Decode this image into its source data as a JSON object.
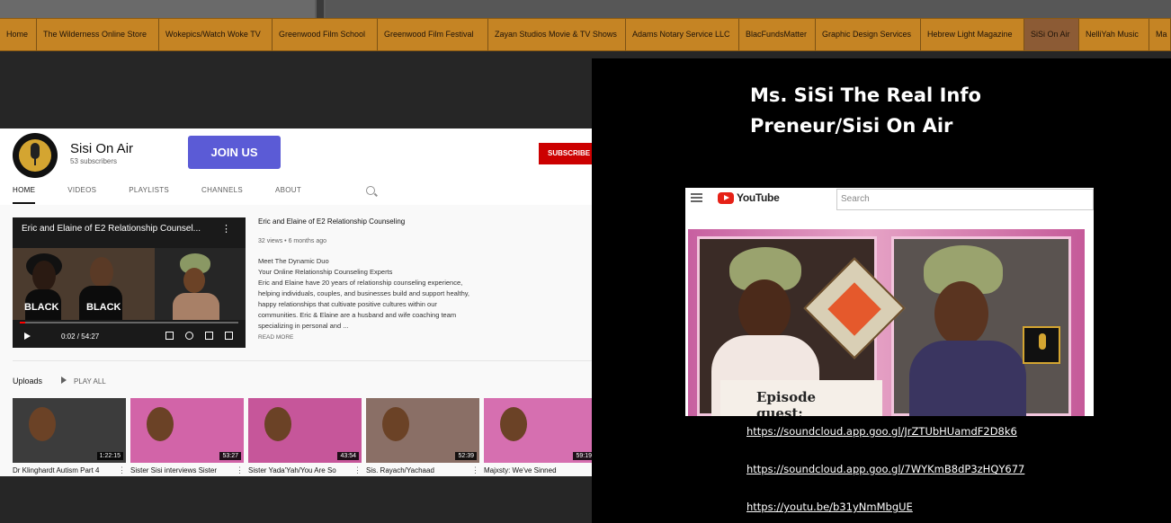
{
  "nav": {
    "items": [
      {
        "label": "Home",
        "width": 41
      },
      {
        "label": "The Wilderness Online Store",
        "width": 136
      },
      {
        "label": "Wokepics/Watch Woke TV",
        "width": 126
      },
      {
        "label": "Greenwood Film School",
        "width": 117
      },
      {
        "label": "Greenwood Film Festival",
        "width": 123
      },
      {
        "label": "Zayan Studios Movie & TV Shows",
        "width": 153
      },
      {
        "label": "Adams Notary Service LLC",
        "width": 126
      },
      {
        "label": "BlacFundsMatter",
        "width": 85
      },
      {
        "label": "Graphic Design Services",
        "width": 117
      },
      {
        "label": "Hebrew Light Magazine",
        "width": 115
      },
      {
        "label": "SiSi On Air",
        "width": 61,
        "active": true
      },
      {
        "label": "NelliYah Music",
        "width": 78
      },
      {
        "label": "Ma",
        "width": 24
      }
    ]
  },
  "youtube": {
    "channel_name": "Sisi On Air",
    "subscribers": "53 subscribers",
    "join_label": "JOIN US",
    "subscribe_label": "SUBSCRIBE",
    "tabs": [
      "HOME",
      "VIDEOS",
      "PLAYLISTS",
      "CHANNELS",
      "ABOUT"
    ],
    "featured": {
      "overlay_title": "Eric and Elaine of E2 Relationship Counsel...",
      "black_text_1": "BLACK",
      "black_text_2": "BLACK",
      "time": "0:02 / 54:27",
      "title": "Eric and Elaine of E2 Relationship Counseling",
      "meta": "32 views • 6 months ago",
      "description": "Meet The Dynamic Duo\nYour Online Relationship Counseling Experts\nEric and Elaine have 20 years of relationship counseling experience, helping individuals, couples, and businesses build and support healthy, happy relationships that cultivate positive cultures within our communities. Eric & Elaine are a husband and wife coaching team specializing in personal and ...",
      "read_more": "READ MORE"
    },
    "uploads_label": "Uploads",
    "play_all_label": "PLAY ALL",
    "uploads": [
      {
        "title": "Dr Klinghardt Autism Part 4",
        "duration": "1:22:15",
        "color": "#3c3c3c"
      },
      {
        "title": "Sister Sisi interviews Sister",
        "duration": "53:27",
        "color": "#d264a8"
      },
      {
        "title": "Sister Yada'Yah/You Are So",
        "duration": "43:54",
        "color": "#c6569a"
      },
      {
        "title": "Sis. Rayach/Yachaad",
        "duration": "52:39",
        "color": "#8a6f66"
      },
      {
        "title": "Majxsty: We've Sinned",
        "duration": "59:19",
        "color": "#d66fb0"
      }
    ]
  },
  "right": {
    "title_line1": "Ms. SiSi The Real Info",
    "title_line2": "Preneur/Sisi On Air",
    "embed": {
      "brand": "YouTube",
      "search_placeholder": "Search",
      "episode_text": "Episode guest:"
    },
    "links": [
      "https://soundcloud.app.goo.gl/JrZTUbHUamdF2D8k6",
      "https://soundcloud.app.goo.gl/7WYKmB8dP3zHQY677",
      "https://youtu.be/b31yNmMbgUE"
    ]
  }
}
